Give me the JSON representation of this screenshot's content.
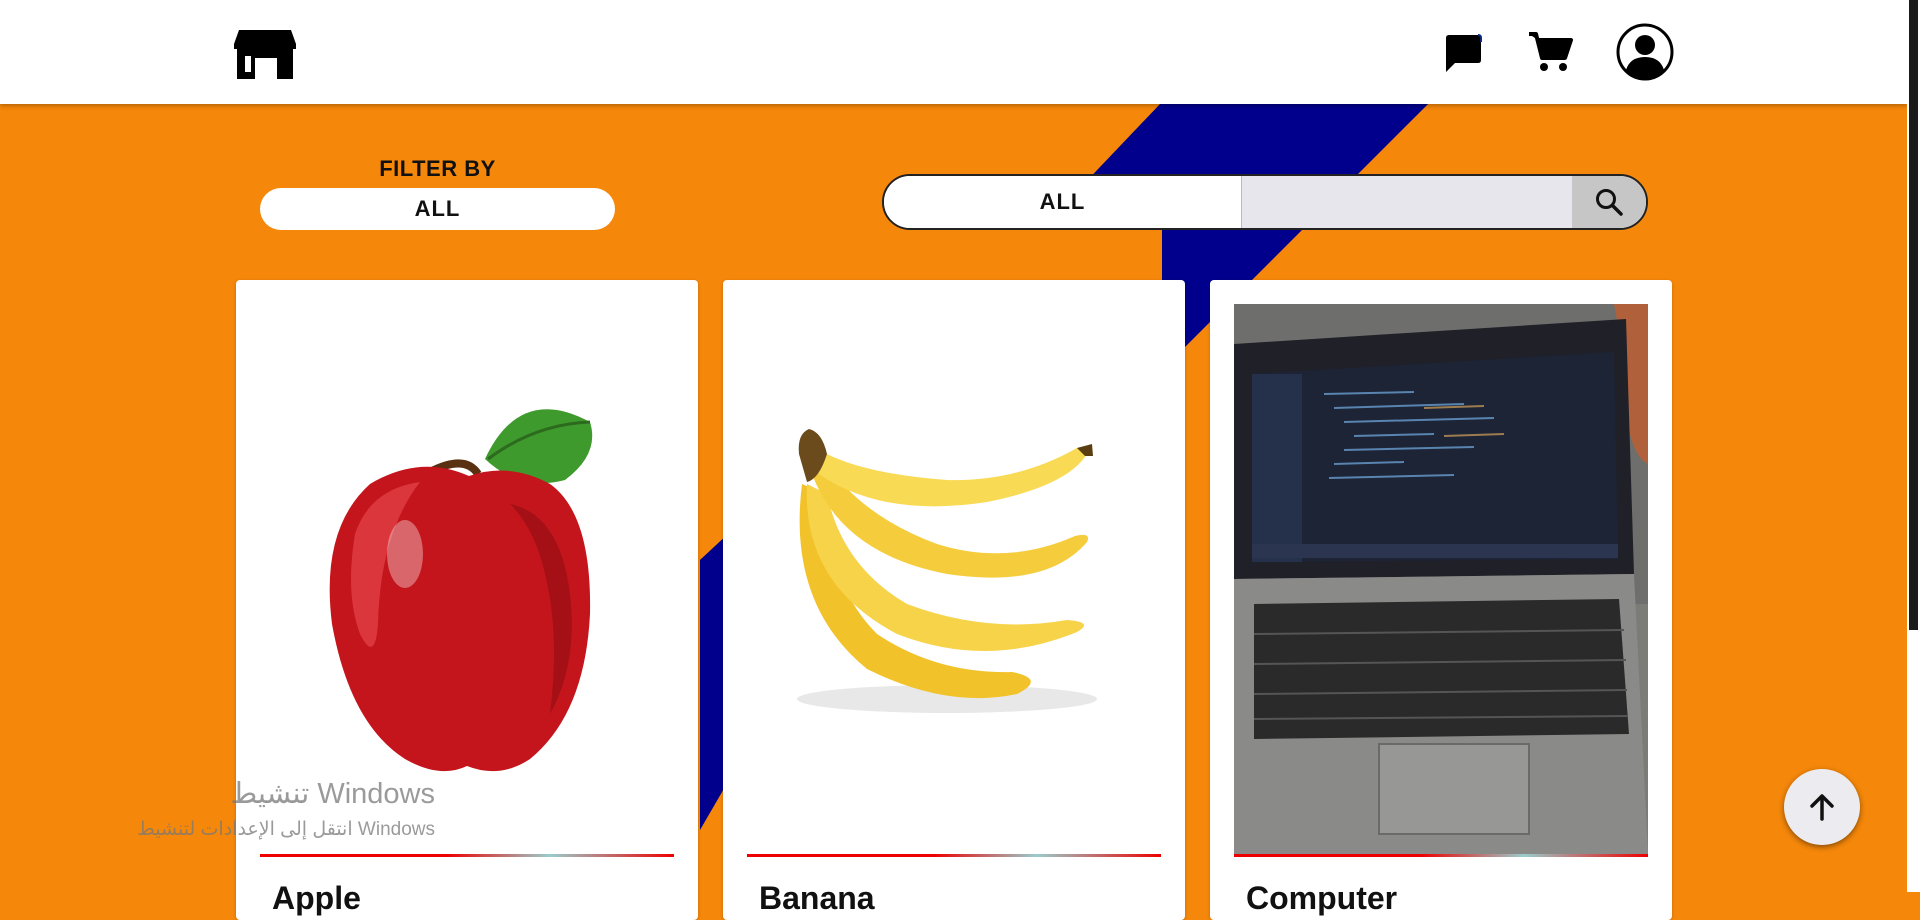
{
  "header": {
    "logo_icon": "storefront-icon",
    "icons": [
      "chat-bubble-icon",
      "cart-icon",
      "user-profile-icon"
    ]
  },
  "filter": {
    "label": "FILTER BY",
    "selected": "ALL"
  },
  "search": {
    "category": "ALL",
    "value": "",
    "button_icon": "search-icon"
  },
  "products": [
    {
      "title": "Apple",
      "image": "apple"
    },
    {
      "title": "Banana",
      "image": "banana"
    },
    {
      "title": "Computer",
      "image": "laptop"
    }
  ],
  "watermark": {
    "line1": "تنشيط Windows",
    "line2": "انتقل إلى الإعدادات لتنشيط Windows"
  },
  "colors": {
    "background": "#f5870a",
    "stripe": "#000090",
    "header": "#ffffff",
    "divider": "#e00000"
  }
}
